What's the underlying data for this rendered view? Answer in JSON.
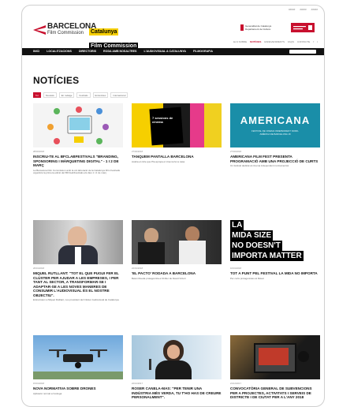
{
  "top_links": [
    "#####",
    "#####",
    "#####"
  ],
  "logo_bcn": {
    "line1": "BARCELONA",
    "line2": "Film Commission"
  },
  "logo_cat": {
    "line1": "Catalunya",
    "line2": "Film Commission"
  },
  "generalitat": {
    "line1": "Generalitat de Catalunya",
    "line2": "Departament de Cultura"
  },
  "secondary_nav": {
    "items": [
      "ELS SOBRE",
      "NOTÍCIES",
      "ESDEVENIMENTS",
      "FAQS",
      "CONTACTE",
      "f",
      "t"
    ],
    "active_index": 1
  },
  "main_nav": [
    "INICI",
    "LOCALITZACIONS",
    "DIRECTORIS",
    "RODA AMB NOSALTRES",
    "L'AUDIOVISUAL A CATALUNYA",
    "FILMOGRAFIA"
  ],
  "page_title": "NOTÍCIES",
  "filters": {
    "items": [
      "Tot",
      "Novetats",
      "En rodatge",
      "Festivals",
      "Entrevistes",
      "Internacional"
    ],
    "active_index": 0
  },
  "news": [
    {
      "date": "28/02/2018",
      "title": "INSCRIU-TE AL BFCLABFESTIVALS \"BRANDING, SPONSORING I MÀRQUETING DIGITAL\" - 1 I 2 DE MARÇ",
      "desc": "La Barcelona Film Commission amb la col·laboració de la Catalunya Film Festivals organitza la primera edició del BFCLabFestivals els dies 1 i 2 de març."
    },
    {
      "date": "27/02/2018",
      "title": "TANQUEM PANTALLA BARCELONA",
      "desc": "Acaba el cicle que Pla apropa el cinema fet a casa"
    },
    {
      "date": "27/02/2018",
      "title": "AMERICANA FILM FEST PRESENTA PROGRAMACIÓ AMB UNA PROJECCIÓ DE CURTS",
      "desc": "Un festival dedicat al cinema independent nord-americà"
    },
    {
      "date": "26/01/2018",
      "title": "MIQUEL RUTLLANT: \"TOT EL QUE PUGUI FER EL CLÚSTER PER AJUDAR A LES EMPRESES, I PER TANT AL SECTOR, A TRANSFORMAR-SE I ADAPTAR-SE A LES NOVES MANERES DE CONSUMIR L'AUDIOVISUAL ÉS EL NOSTRE OBJECTIU\".",
      "desc": "Entrevistem a Miquel Rutllant, nou president del Clúster Audiovisual de Catalunya."
    },
    {
      "date": "22/01/2018",
      "title": "'EL PACTO' RODADA A BARCELONA",
      "desc": "Belén Rueda protagonitza el thriller de David Victori"
    },
    {
      "date": "16/01/2018",
      "title": "TOT A PUNT PEL FESTIVAL LA MIDA NO IMPORTA",
      "desc": "Per curts protagonistes al Raval"
    },
    {
      "date": "15/01/2018",
      "title": "NOVA NORMATIVA SOBRE DRONES",
      "desc": "Aplicació normal a l'estiuga"
    },
    {
      "date": "22/12/2017",
      "title": "ROSER CANELA-MAS: \"PER TENIR UNA INDÚSTRIA MÉS VERDA, TU T'HO HAS DE CREURE PERSONALMENT\".",
      "desc": ""
    },
    {
      "date": "21/12/2017",
      "title": "CONVOCATÒRIA GENERAL DE SUBVENCIONS PER A PROJECTES, ACTIVITATS I SERVEIS DE DISTRICTE I DE CIUTAT PER A L'ANY 2018",
      "desc": ""
    }
  ],
  "thumb_text": {
    "americana": "AMERICANA",
    "americana_sub": "FESTIVAL DE CINEMA INDEPENDENT NORD-AMÈRICA DE BARCELONA 18",
    "sessions": "7 sessions de cinema",
    "lmm1": "LA",
    "lmm2": "MIDA SIZE",
    "lmm3": "NO DOESN'T",
    "lmm4": "IMPORTA MATTER"
  },
  "colors": {
    "accent": "#c8102e",
    "nav_bg": "#111111",
    "yellow": "#f6cf00"
  }
}
